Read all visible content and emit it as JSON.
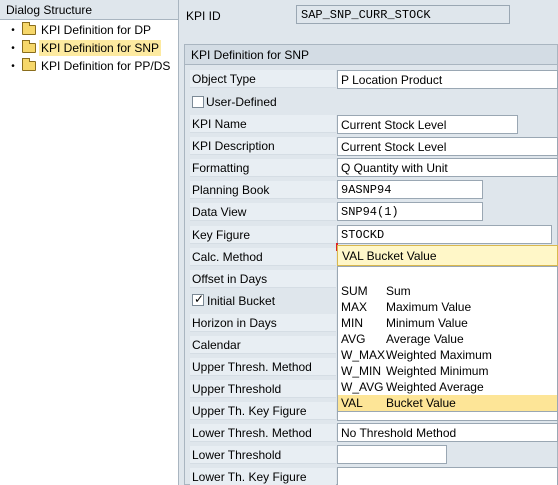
{
  "tree": {
    "header": "Dialog Structure",
    "items": [
      {
        "label": "KPI Definition for DP",
        "selected": false
      },
      {
        "label": "KPI Definition for SNP",
        "selected": true
      },
      {
        "label": "KPI Definition for PP/DS",
        "selected": false
      }
    ]
  },
  "kpi_id": {
    "label": "KPI ID",
    "value": "SAP_SNP_CURR_STOCK"
  },
  "group": {
    "title": "KPI Definition for SNP"
  },
  "form": {
    "object_type": {
      "label": "Object Type",
      "value": "P Location Product"
    },
    "user_defined": {
      "label": "User-Defined",
      "checked": false
    },
    "kpi_name": {
      "label": "KPI Name",
      "value": "Current Stock Level"
    },
    "kpi_description": {
      "label": "KPI Description",
      "value": "Current Stock Level"
    },
    "formatting": {
      "label": "Formatting",
      "value": "Q Quantity with Unit"
    },
    "planning_book": {
      "label": "Planning Book",
      "value": "9ASNP94"
    },
    "data_view": {
      "label": "Data View",
      "value": "SNP94(1)"
    },
    "key_figure": {
      "label": "Key Figure",
      "value": "STOCKD"
    },
    "calc_method": {
      "label": "Calc. Method",
      "value": "VAL Bucket Value"
    },
    "offset_days": {
      "label": "Offset in Days"
    },
    "initial_bucket": {
      "label": "Initial Bucket",
      "checked": true
    },
    "horizon_days": {
      "label": "Horizon in Days"
    },
    "calendar": {
      "label": "Calendar"
    },
    "upper_thresh_method": {
      "label": "Upper Thresh. Method"
    },
    "upper_threshold": {
      "label": "Upper Threshold"
    },
    "upper_th_key_figure": {
      "label": "Upper Th. Key Figure"
    },
    "lower_thresh_method": {
      "label": "Lower Thresh. Method",
      "value": "No Threshold Method"
    },
    "lower_threshold": {
      "label": "Lower Threshold"
    },
    "lower_th_key_figure": {
      "label": "Lower Th. Key Figure"
    }
  },
  "calc_options": [
    {
      "code": "SUM",
      "text": "Sum"
    },
    {
      "code": "MAX",
      "text": "Maximum Value"
    },
    {
      "code": "MIN",
      "text": "Minimum Value"
    },
    {
      "code": "AVG",
      "text": "Average Value"
    },
    {
      "code": "W_MAX",
      "text": "Weighted Maximum"
    },
    {
      "code": "W_MIN",
      "text": "Weighted Minimum"
    },
    {
      "code": "W_AVG",
      "text": "Weighted Average"
    },
    {
      "code": "VAL",
      "text": "Bucket Value"
    }
  ],
  "colors": {
    "selected_row": "#fde597",
    "tree_selected": "#fdeaa0"
  }
}
